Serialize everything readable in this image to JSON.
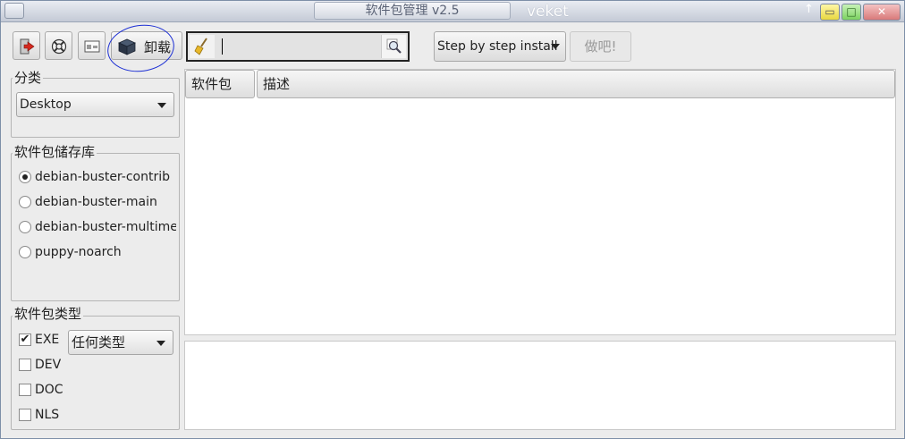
{
  "window": {
    "title": "软件包管理 v2.5",
    "app_name": "veket",
    "controls": {
      "up_arrow": "↑",
      "minimize": "▭",
      "maximize": "□",
      "close": "✕"
    }
  },
  "toolbar": {
    "icons": [
      "exit-icon",
      "lifebuoy-icon",
      "window-icon",
      "package-icon"
    ],
    "uninstall_label": "卸载",
    "search_value": "",
    "mode_selected": "Step by step install",
    "doit_label": "做吧!"
  },
  "category": {
    "legend": "分类",
    "selected": "Desktop"
  },
  "repositories": {
    "legend": "软件包储存库",
    "items": [
      {
        "label": "debian-buster-contrib",
        "selected": true
      },
      {
        "label": "debian-buster-main",
        "selected": false
      },
      {
        "label": "debian-buster-multimedia",
        "selected": false
      },
      {
        "label": "puppy-noarch",
        "selected": false
      }
    ]
  },
  "package_types": {
    "legend": "软件包类型",
    "type_selected": "任何类型",
    "checks": [
      {
        "label": "EXE",
        "checked": true
      },
      {
        "label": "DEV",
        "checked": false
      },
      {
        "label": "DOC",
        "checked": false
      },
      {
        "label": "NLS",
        "checked": false
      }
    ],
    "check_mark": "✔"
  },
  "list": {
    "columns": [
      "软件包",
      "描述"
    ]
  },
  "colors": {
    "accent_circle": "#1c2fd4",
    "titlebar_text": "#5a6275"
  }
}
